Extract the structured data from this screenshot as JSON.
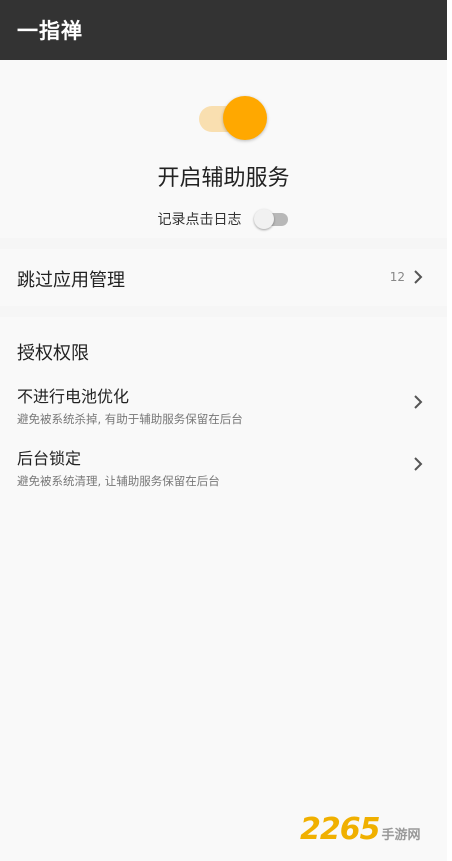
{
  "appbar": {
    "title": "一指禅"
  },
  "service": {
    "label": "开启辅助服务",
    "enabled": true,
    "log_label": "记录点击日志",
    "log_enabled": false
  },
  "skip_apps": {
    "label": "跳过应用管理",
    "count": "12"
  },
  "permissions": {
    "section_title": "授权权限",
    "items": [
      {
        "title": "不进行电池优化",
        "subtitle": "避免被系统杀掉, 有助于辅助服务保留在后台"
      },
      {
        "title": "后台锁定",
        "subtitle": "避免被系统清理, 让辅助服务保留在后台"
      }
    ]
  },
  "watermark": {
    "number": "2265",
    "suffix": "手游网"
  },
  "colors": {
    "appbar": "#333333",
    "accent": "#ffa800",
    "accent_track": "#f9dfb0",
    "background": "#f6f6f6"
  },
  "icons": {
    "chevron": "chevron-right-icon"
  }
}
